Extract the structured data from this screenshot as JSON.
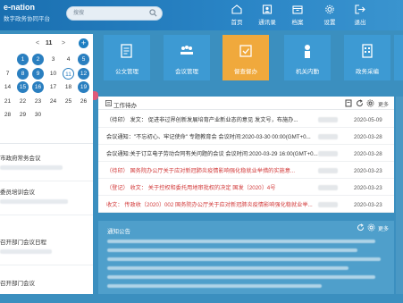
{
  "header": {
    "app_title": "e-nation",
    "app_subtitle": "数字政务协同平台",
    "search": {
      "placeholder": "搜搜"
    },
    "nav": [
      {
        "label": "首页",
        "icon": "home-icon"
      },
      {
        "label": "通讯录",
        "icon": "contacts-icon"
      },
      {
        "label": "档案",
        "icon": "archive-icon"
      },
      {
        "label": "设置",
        "icon": "gear-icon"
      },
      {
        "label": "退出",
        "icon": "logout-icon"
      }
    ]
  },
  "calendar": {
    "prev": "<",
    "month": "11",
    "next": ">",
    "add": "+",
    "rows": [
      [
        "",
        "1",
        "2",
        "3",
        "4",
        "5"
      ],
      [
        "7",
        "8",
        "9",
        "10",
        "11",
        "12"
      ],
      [
        "14",
        "15",
        "16",
        "17",
        "18",
        "19"
      ],
      [
        "21",
        "22",
        "23",
        "24",
        "25",
        "26"
      ],
      [
        "28",
        "29",
        "30",
        "",
        "",
        ""
      ],
      [
        "",
        "",
        "",
        "",
        "",
        ""
      ]
    ]
  },
  "left_list": [
    {
      "title": "市政府常务会议"
    },
    {
      "title": "委员培训会议"
    },
    {
      "title": "召开部门会议日程"
    },
    {
      "title": "召开部门会议"
    }
  ],
  "tiles": [
    {
      "label": "公文管理",
      "icon": "document-icon",
      "color": "#3d9ad3"
    },
    {
      "label": "会议管理",
      "icon": "meeting-icon",
      "color": "#3d9ad3"
    },
    {
      "label": "督查督办",
      "icon": "supervise-icon",
      "color": "#f0a93c"
    },
    {
      "label": "机关内勤",
      "icon": "person-icon",
      "color": "#3d9ad3"
    },
    {
      "label": "政务采编",
      "icon": "building-icon",
      "color": "#3d9ad3"
    }
  ],
  "work": {
    "title": "工作待办",
    "more": "更多",
    "rows": [
      {
        "text": "（待印）  发文：  促进非过界创新发展培育产业新业态的意见 发文号，布施办...",
        "red": false,
        "date": "2020-05-09"
      },
      {
        "text": "会议通知：\"不忘初心、牢记使命\" 专题教育会 会议时间:2020-03-30 00:00(GMT+0...",
        "red": false,
        "date": "2020-03-28"
      },
      {
        "text": "会议通知:关于订立电子劳动合同有关问题的会议 会议时间:2020-03-29 16:00(GMT+0...",
        "red": false,
        "date": "2020-03-28"
      },
      {
        "text": "（待印）  国务院办公厅关于应对新冠肺炎疫情影响强化稳就业举措的实施意...",
        "red": true,
        "date": "2020-03-23"
      },
      {
        "text": "（登记）  收文：  关于控权和委托用地审批权的决定  国发〔2020〕4号",
        "red": true,
        "date": "2020-03-23"
      },
      {
        "text": "收文：  传政收〔2020〕002  国务院办公厅关于应对新冠肺炎疫情影响强化稳就业举...",
        "red": true,
        "date": "2020-03-23"
      }
    ]
  },
  "notice": {
    "title": "通知公告",
    "more": "更多"
  }
}
